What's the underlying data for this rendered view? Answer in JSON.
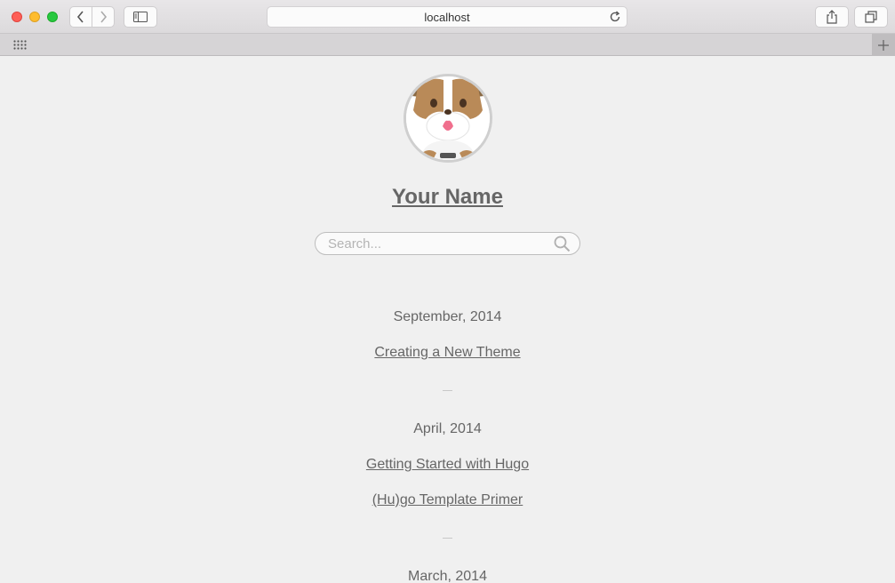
{
  "browser": {
    "address": "localhost"
  },
  "site": {
    "name": "Your Name",
    "search_placeholder": "Search..."
  },
  "archive": [
    {
      "month": "September, 2014",
      "posts": [
        "Creating a New Theme"
      ]
    },
    {
      "month": "April, 2014",
      "posts": [
        "Getting Started with Hugo",
        "(Hu)go Template Primer"
      ]
    },
    {
      "month": "March, 2014",
      "posts": []
    }
  ],
  "colors": {
    "page_bg": "#f0f0f0",
    "text": "#666666",
    "close": "#fe5f57",
    "minimize": "#febc2e",
    "maximize": "#28c840"
  }
}
